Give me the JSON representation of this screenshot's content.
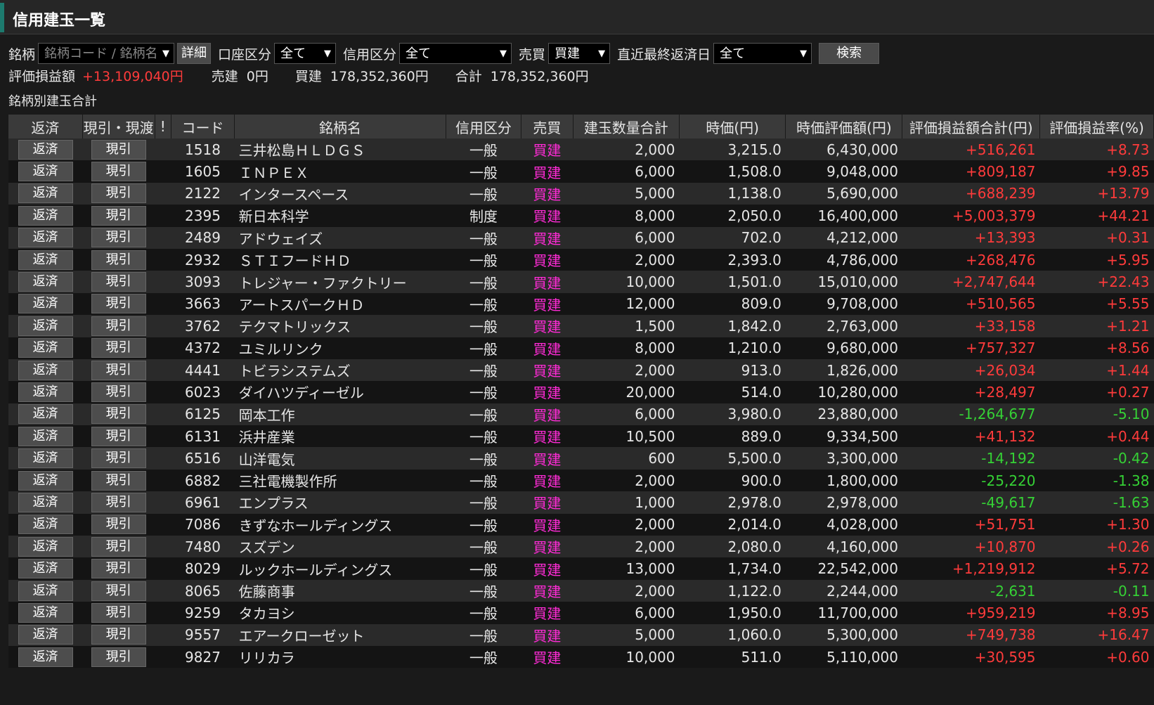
{
  "window": {
    "title": "信用建玉一覧"
  },
  "filters": {
    "meigara_label": "銘柄",
    "meigara_placeholder": "銘柄コード / 銘柄名",
    "detail_button": "詳細",
    "account_label": "口座区分",
    "account_value": "全て",
    "credit_label": "信用区分",
    "credit_value": "全て",
    "baibai_label": "売買",
    "baibai_value": "買建",
    "due_label": "直近最終返済日",
    "due_value": "全て",
    "search_button": "検索"
  },
  "summary": {
    "pl_label": "評価損益額",
    "pl_value": "+13,109,040円",
    "sell_label": "売建",
    "sell_value": "0円",
    "buy_label": "買建",
    "buy_value": "178,352,360円",
    "total_label": "合計",
    "total_value": "178,352,360円"
  },
  "subheading": "銘柄別建玉合計",
  "table": {
    "headers": [
      "返済",
      "現引・現渡",
      "!",
      "コード",
      "銘柄名",
      "信用区分",
      "売買",
      "建玉数量合計",
      "時価(円)",
      "時価評価額(円)",
      "評価損益額合計(円)",
      "評価損益率(%)"
    ],
    "action_labels": {
      "repay": "返済",
      "genbiki": "現引"
    },
    "rows": [
      {
        "code": "1518",
        "name": "三井松島ＨＬＤＧＳ",
        "kubun": "一般",
        "baibai": "買建",
        "qty": "2,000",
        "price": "3,215.0",
        "value": "6,430,000",
        "pl": "+516,261",
        "rate": "+8.73"
      },
      {
        "code": "1605",
        "name": "ＩＮＰＥＸ",
        "kubun": "一般",
        "baibai": "買建",
        "qty": "6,000",
        "price": "1,508.0",
        "value": "9,048,000",
        "pl": "+809,187",
        "rate": "+9.85"
      },
      {
        "code": "2122",
        "name": "インタースペース",
        "kubun": "一般",
        "baibai": "買建",
        "qty": "5,000",
        "price": "1,138.0",
        "value": "5,690,000",
        "pl": "+688,239",
        "rate": "+13.79"
      },
      {
        "code": "2395",
        "name": "新日本科学",
        "kubun": "制度",
        "baibai": "買建",
        "qty": "8,000",
        "price": "2,050.0",
        "value": "16,400,000",
        "pl": "+5,003,379",
        "rate": "+44.21"
      },
      {
        "code": "2489",
        "name": "アドウェイズ",
        "kubun": "一般",
        "baibai": "買建",
        "qty": "6,000",
        "price": "702.0",
        "value": "4,212,000",
        "pl": "+13,393",
        "rate": "+0.31"
      },
      {
        "code": "2932",
        "name": "ＳＴＩフードＨＤ",
        "kubun": "一般",
        "baibai": "買建",
        "qty": "2,000",
        "price": "2,393.0",
        "value": "4,786,000",
        "pl": "+268,476",
        "rate": "+5.95"
      },
      {
        "code": "3093",
        "name": "トレジャー・ファクトリー",
        "kubun": "一般",
        "baibai": "買建",
        "qty": "10,000",
        "price": "1,501.0",
        "value": "15,010,000",
        "pl": "+2,747,644",
        "rate": "+22.43"
      },
      {
        "code": "3663",
        "name": "アートスパークＨＤ",
        "kubun": "一般",
        "baibai": "買建",
        "qty": "12,000",
        "price": "809.0",
        "value": "9,708,000",
        "pl": "+510,565",
        "rate": "+5.55"
      },
      {
        "code": "3762",
        "name": "テクマトリックス",
        "kubun": "一般",
        "baibai": "買建",
        "qty": "1,500",
        "price": "1,842.0",
        "value": "2,763,000",
        "pl": "+33,158",
        "rate": "+1.21"
      },
      {
        "code": "4372",
        "name": "ユミルリンク",
        "kubun": "一般",
        "baibai": "買建",
        "qty": "8,000",
        "price": "1,210.0",
        "value": "9,680,000",
        "pl": "+757,327",
        "rate": "+8.56"
      },
      {
        "code": "4441",
        "name": "トビラシステムズ",
        "kubun": "一般",
        "baibai": "買建",
        "qty": "2,000",
        "price": "913.0",
        "value": "1,826,000",
        "pl": "+26,034",
        "rate": "+1.44"
      },
      {
        "code": "6023",
        "name": "ダイハツディーゼル",
        "kubun": "一般",
        "baibai": "買建",
        "qty": "20,000",
        "price": "514.0",
        "value": "10,280,000",
        "pl": "+28,497",
        "rate": "+0.27"
      },
      {
        "code": "6125",
        "name": "岡本工作",
        "kubun": "一般",
        "baibai": "買建",
        "qty": "6,000",
        "price": "3,980.0",
        "value": "23,880,000",
        "pl": "-1,264,677",
        "rate": "-5.10"
      },
      {
        "code": "6131",
        "name": "浜井産業",
        "kubun": "一般",
        "baibai": "買建",
        "qty": "10,500",
        "price": "889.0",
        "value": "9,334,500",
        "pl": "+41,132",
        "rate": "+0.44"
      },
      {
        "code": "6516",
        "name": "山洋電気",
        "kubun": "一般",
        "baibai": "買建",
        "qty": "600",
        "price": "5,500.0",
        "value": "3,300,000",
        "pl": "-14,192",
        "rate": "-0.42"
      },
      {
        "code": "6882",
        "name": "三社電機製作所",
        "kubun": "一般",
        "baibai": "買建",
        "qty": "2,000",
        "price": "900.0",
        "value": "1,800,000",
        "pl": "-25,220",
        "rate": "-1.38"
      },
      {
        "code": "6961",
        "name": "エンプラス",
        "kubun": "一般",
        "baibai": "買建",
        "qty": "1,000",
        "price": "2,978.0",
        "value": "2,978,000",
        "pl": "-49,617",
        "rate": "-1.63"
      },
      {
        "code": "7086",
        "name": "きずなホールディングス",
        "kubun": "一般",
        "baibai": "買建",
        "qty": "2,000",
        "price": "2,014.0",
        "value": "4,028,000",
        "pl": "+51,751",
        "rate": "+1.30"
      },
      {
        "code": "7480",
        "name": "スズデン",
        "kubun": "一般",
        "baibai": "買建",
        "qty": "2,000",
        "price": "2,080.0",
        "value": "4,160,000",
        "pl": "+10,870",
        "rate": "+0.26"
      },
      {
        "code": "8029",
        "name": "ルックホールディングス",
        "kubun": "一般",
        "baibai": "買建",
        "qty": "13,000",
        "price": "1,734.0",
        "value": "22,542,000",
        "pl": "+1,219,912",
        "rate": "+5.72"
      },
      {
        "code": "8065",
        "name": "佐藤商事",
        "kubun": "一般",
        "baibai": "買建",
        "qty": "2,000",
        "price": "1,122.0",
        "value": "2,244,000",
        "pl": "-2,631",
        "rate": "-0.11"
      },
      {
        "code": "9259",
        "name": "タカヨシ",
        "kubun": "一般",
        "baibai": "買建",
        "qty": "6,000",
        "price": "1,950.0",
        "value": "11,700,000",
        "pl": "+959,219",
        "rate": "+8.95"
      },
      {
        "code": "9557",
        "name": "エアークローゼット",
        "kubun": "一般",
        "baibai": "買建",
        "qty": "5,000",
        "price": "1,060.0",
        "value": "5,300,000",
        "pl": "+749,738",
        "rate": "+16.47"
      },
      {
        "code": "9827",
        "name": "リリカラ",
        "kubun": "一般",
        "baibai": "買建",
        "qty": "10,000",
        "price": "511.0",
        "value": "5,110,000",
        "pl": "+30,595",
        "rate": "+0.60"
      }
    ]
  },
  "colors": {
    "positive": "#ff3b3b",
    "negative": "#35d135",
    "buy": "#ff2bd6",
    "accent": "#1d7a6e"
  }
}
